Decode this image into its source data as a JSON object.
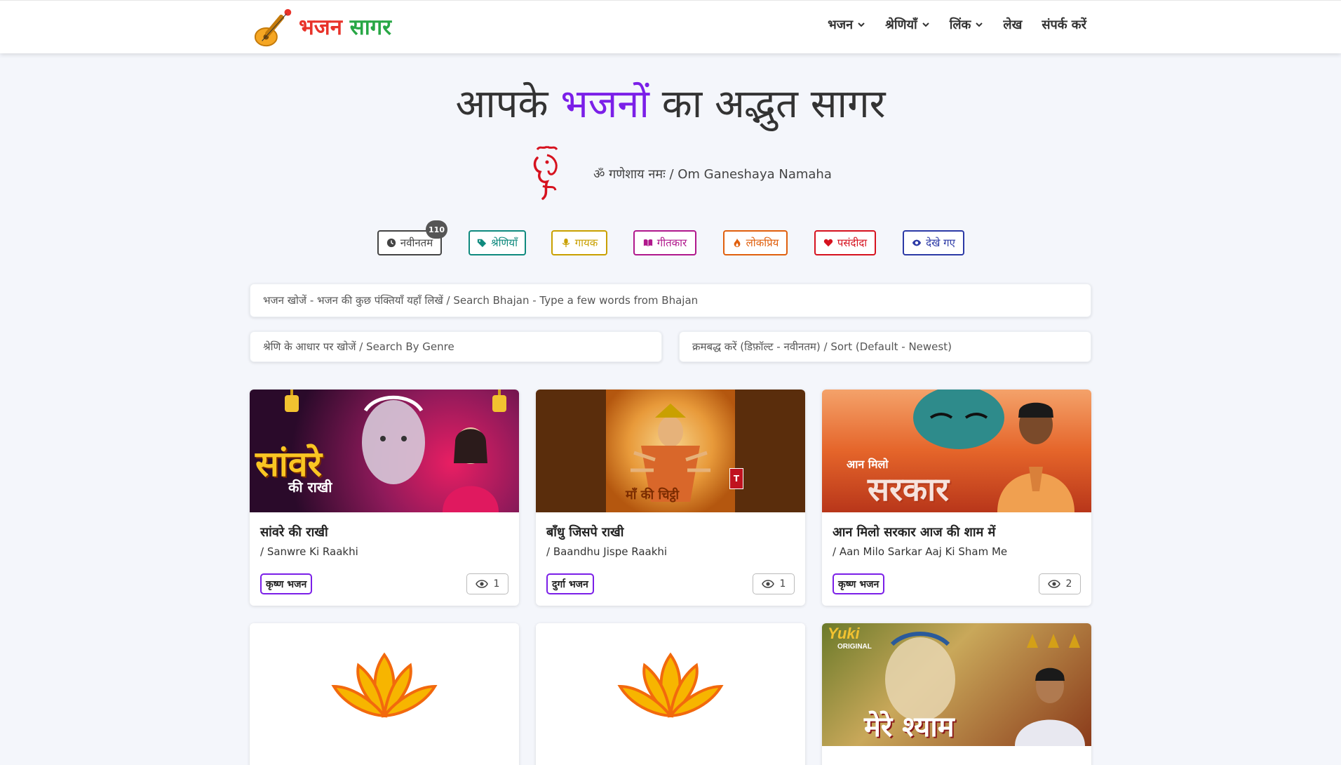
{
  "brand": {
    "name_part1": "भजन",
    "name_part2": "सागर",
    "logo_icon": "sitar-icon"
  },
  "nav": {
    "items": [
      {
        "label": "भजन",
        "has_dropdown": true
      },
      {
        "label": "श्रेणियाँ",
        "has_dropdown": true
      },
      {
        "label": "लिंक",
        "has_dropdown": true
      },
      {
        "label": "लेख",
        "has_dropdown": false
      },
      {
        "label": "संपर्क करें",
        "has_dropdown": false
      }
    ]
  },
  "hero": {
    "title_before": "आपके",
    "title_accent": "भजनों",
    "title_after": "का अद्भुत सागर",
    "mantra": "ॐ गणेशाय नमः / Om Ganeshaya Namaha"
  },
  "filters": [
    {
      "label": "नवीनतम",
      "icon": "clock-icon",
      "color": "#444444",
      "badge": "110"
    },
    {
      "label": "श्रेणियाँ",
      "icon": "tags-icon",
      "color": "#0f8a7e"
    },
    {
      "label": "गायक",
      "icon": "microphone-icon",
      "color": "#c9a000"
    },
    {
      "label": "गीतकार",
      "icon": "book-icon",
      "color": "#b0188c"
    },
    {
      "label": "लोकप्रिय",
      "icon": "fire-icon",
      "color": "#e0600e"
    },
    {
      "label": "पसंदीदा",
      "icon": "heart-icon",
      "color": "#d6121f"
    },
    {
      "label": "देखे गए",
      "icon": "eye-icon",
      "color": "#2c3aa6"
    }
  ],
  "search": {
    "placeholder": "भजन खोजें - भजन की कुछ पंक्तियाँ यहाँ लिखें / Search Bhajan - Type a few words from Bhajan",
    "genre_placeholder": "श्रेणि के आधार पर खोजें / Search By Genre",
    "sort_placeholder": "क्रमबद्ध करें (डिफ़ॉल्ट - नवीनतम) / Sort (Default - Newest)"
  },
  "cards": [
    {
      "title": "सांवरे की राखी",
      "subtitle": "/ Sanwre Ki Raakhi",
      "tag": "कृष्ण भजन",
      "views": "1",
      "thumb_text": "सांवरे",
      "thumb_text2": "की राखी"
    },
    {
      "title": "बाँधु जिसपे राखी",
      "subtitle": "/ Baandhu Jispe Raakhi",
      "tag": "दुर्गा भजन",
      "views": "1",
      "thumb_text": "माँ की चिट्ठी"
    },
    {
      "title": "आन मिलो सरकार आज की शाम में",
      "subtitle": "/ Aan Milo Sarkar Aaj Ki Sham Me",
      "tag": "कृष्ण भजन",
      "views": "2",
      "thumb_text": "आन मिलो",
      "thumb_text2": "सरकार"
    }
  ],
  "cards_row2": [
    {
      "thumb": "lotus-icon"
    },
    {
      "thumb": "lotus-icon"
    },
    {
      "thumb_brand": "Yuki",
      "thumb_brand2": "ORIGINAL",
      "thumb_text": "मेरे श्याम"
    }
  ],
  "colors": {
    "accent": "#7b1fe8",
    "brand_red": "#e8332a",
    "brand_green": "#28a745"
  }
}
